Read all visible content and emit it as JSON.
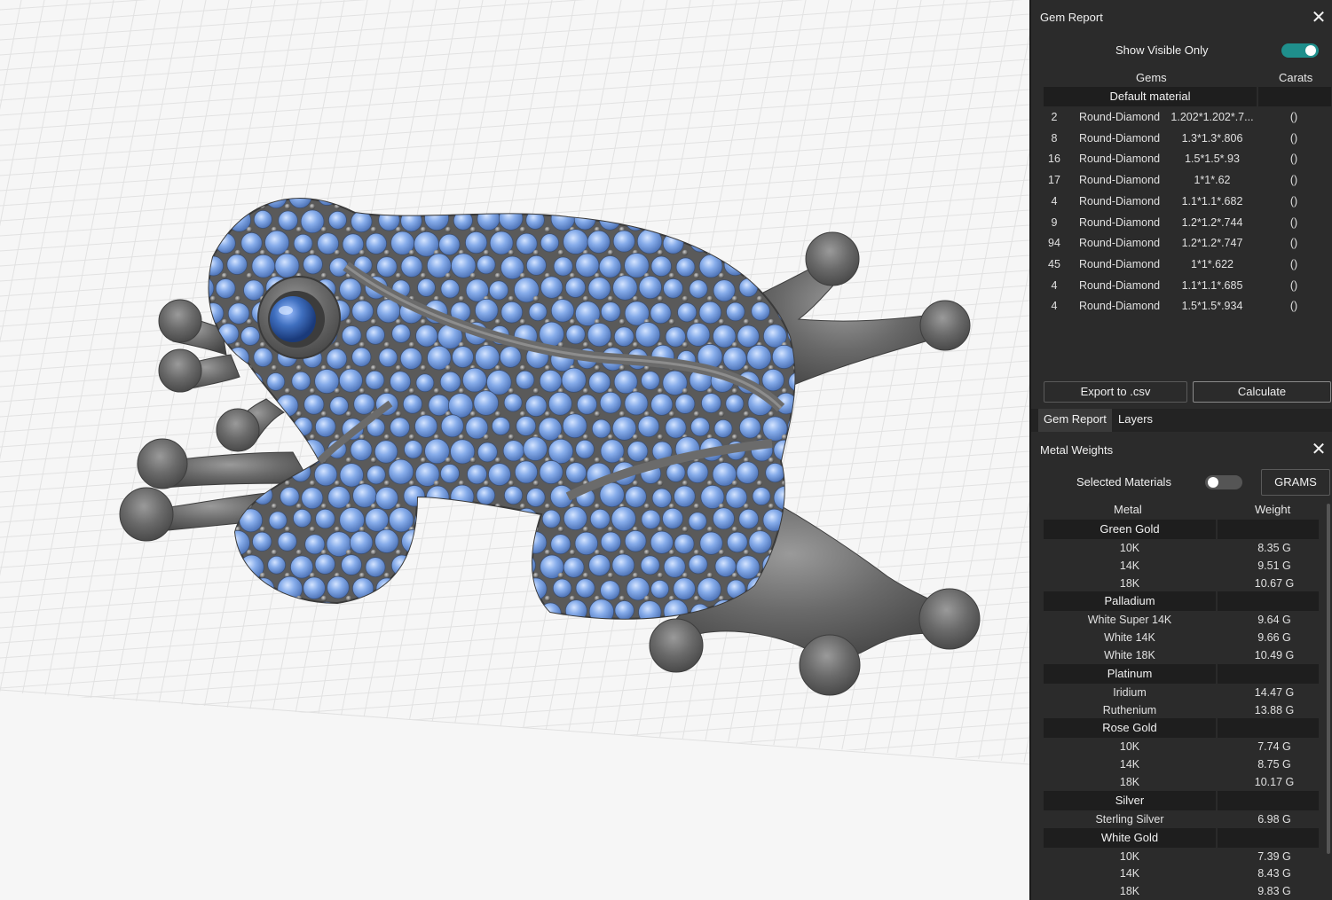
{
  "gem_report": {
    "title": "Gem Report",
    "close_icon": "close-icon",
    "show_visible_label": "Show Visible Only",
    "show_visible_state": "on",
    "col_gems": "Gems",
    "col_carats": "Carats",
    "group": "Default material",
    "rows": [
      {
        "qty": "2",
        "shape": "Round-Diamond",
        "size": "1.202*1.202*.7...",
        "carats": "()"
      },
      {
        "qty": "8",
        "shape": "Round-Diamond",
        "size": "1.3*1.3*.806",
        "carats": "()"
      },
      {
        "qty": "16",
        "shape": "Round-Diamond",
        "size": "1.5*1.5*.93",
        "carats": "()"
      },
      {
        "qty": "17",
        "shape": "Round-Diamond",
        "size": "1*1*.62",
        "carats": "()"
      },
      {
        "qty": "4",
        "shape": "Round-Diamond",
        "size": "1.1*1.1*.682",
        "carats": "()"
      },
      {
        "qty": "9",
        "shape": "Round-Diamond",
        "size": "1.2*1.2*.744",
        "carats": "()"
      },
      {
        "qty": "94",
        "shape": "Round-Diamond",
        "size": "1.2*1.2*.747",
        "carats": "()"
      },
      {
        "qty": "45",
        "shape": "Round-Diamond",
        "size": "1*1*.622",
        "carats": "()"
      },
      {
        "qty": "4",
        "shape": "Round-Diamond",
        "size": "1.1*1.1*.685",
        "carats": "()"
      },
      {
        "qty": "4",
        "shape": "Round-Diamond",
        "size": "1.5*1.5*.934",
        "carats": "()"
      }
    ],
    "export_label": "Export to .csv",
    "calculate_label": "Calculate"
  },
  "tabs": [
    {
      "label": "Gem Report",
      "active": true
    },
    {
      "label": "Layers",
      "active": false
    }
  ],
  "metal_weights": {
    "title": "Metal Weights",
    "selected_materials_label": "Selected Materials",
    "selected_materials_state": "off",
    "units_label": "GRAMS",
    "col_metal": "Metal",
    "col_weight": "Weight",
    "groups": [
      {
        "name": "Green Gold",
        "items": [
          {
            "name": "10K",
            "weight": "8.35 G"
          },
          {
            "name": "14K",
            "weight": "9.51 G"
          },
          {
            "name": "18K",
            "weight": "10.67 G"
          }
        ]
      },
      {
        "name": "Palladium",
        "items": [
          {
            "name": "White Super 14K",
            "weight": "9.64 G"
          },
          {
            "name": "White 14K",
            "weight": "9.66 G"
          },
          {
            "name": "White 18K",
            "weight": "10.49 G"
          }
        ]
      },
      {
        "name": "Platinum",
        "items": [
          {
            "name": "Iridium",
            "weight": "14.47 G"
          },
          {
            "name": "Ruthenium",
            "weight": "13.88 G"
          }
        ]
      },
      {
        "name": "Rose Gold",
        "items": [
          {
            "name": "10K",
            "weight": "7.74 G"
          },
          {
            "name": "14K",
            "weight": "8.75 G"
          },
          {
            "name": "18K",
            "weight": "10.17 G"
          }
        ]
      },
      {
        "name": "Silver",
        "items": [
          {
            "name": "Sterling Silver",
            "weight": "6.98 G"
          }
        ]
      },
      {
        "name": "White Gold",
        "items": [
          {
            "name": "10K",
            "weight": "7.39 G"
          },
          {
            "name": "14K",
            "weight": "8.43 G"
          },
          {
            "name": "18K",
            "weight": "9.83 G"
          }
        ]
      }
    ]
  },
  "colors": {
    "panel_bg": "#2b2b2b",
    "group_bar": "#1e1e1e",
    "toggle_on": "#1f8f8c",
    "gem_blue": "#7fa7e0",
    "metal_gray": "#5f5f5f"
  }
}
